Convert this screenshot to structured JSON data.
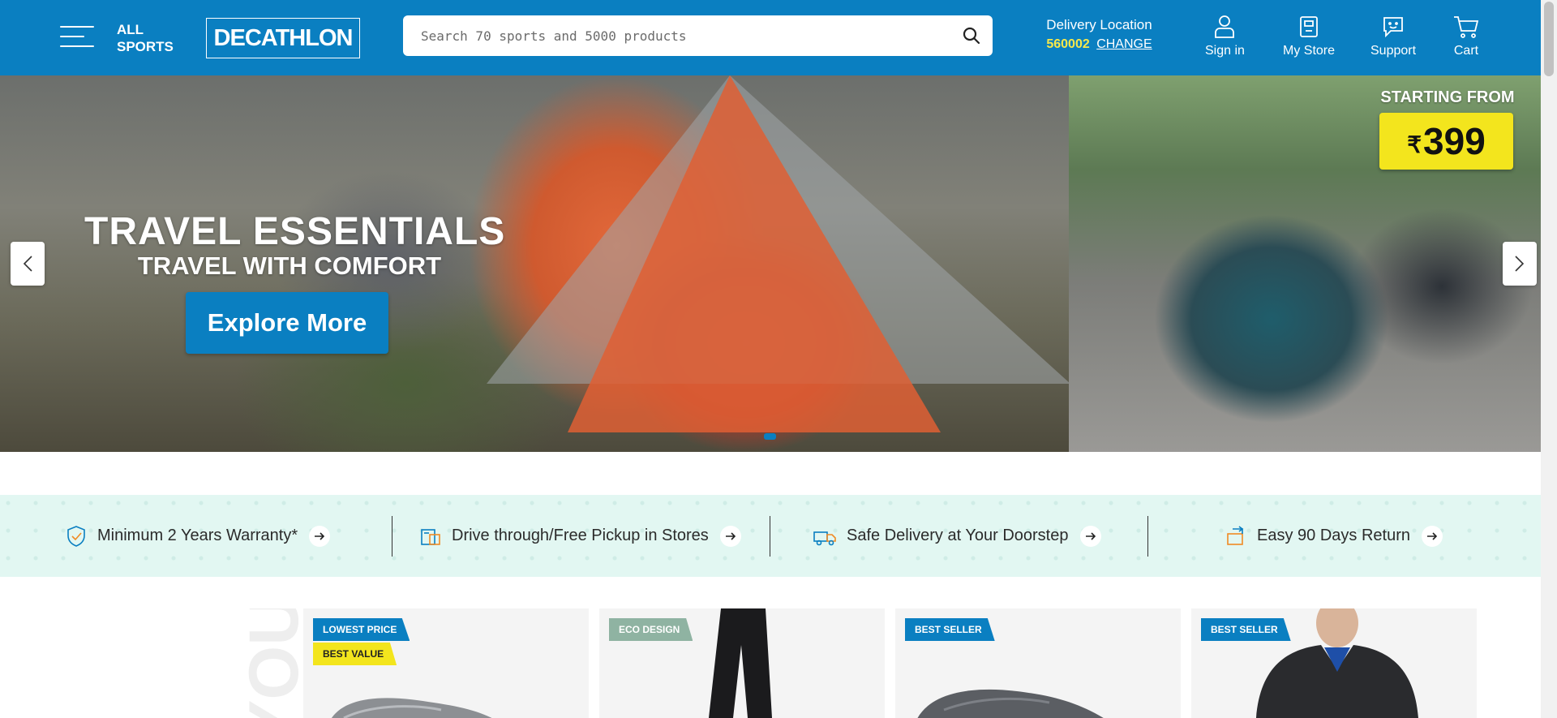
{
  "header": {
    "all_sports_label": "ALL SPORTS",
    "logo_text": "DECATHLON",
    "search_placeholder": "Search 70 sports and 5000 products",
    "delivery_title": "Delivery Location",
    "pincode": "560002",
    "change_label": "CHANGE",
    "nav": [
      {
        "label": "Sign in",
        "icon": "user-icon"
      },
      {
        "label": "My Store",
        "icon": "store-icon"
      },
      {
        "label": "Support",
        "icon": "chat-support-icon"
      },
      {
        "label": "Cart",
        "icon": "cart-icon"
      }
    ]
  },
  "hero": {
    "title": "TRAVEL ESSENTIALS",
    "subtitle": "TRAVEL WITH COMFORT",
    "cta_label": "Explore More",
    "starting_label": "STARTING FROM",
    "currency": "₹",
    "price": "399"
  },
  "benefits": [
    {
      "label": "Minimum 2 Years Warranty*",
      "icon": "warranty-shield-icon"
    },
    {
      "label": "Drive through/Free Pickup in Stores",
      "icon": "store-pickup-icon"
    },
    {
      "label": "Safe Delivery at Your Doorstep",
      "icon": "delivery-truck-icon"
    },
    {
      "label": "Easy 90 Days Return",
      "icon": "return-box-icon"
    }
  ],
  "products": {
    "side_text": "YOU",
    "cards": [
      {
        "tags": [
          "LOWEST PRICE",
          "BEST VALUE"
        ],
        "image": "grey-shoe"
      },
      {
        "tags": [
          "ECO DESIGN"
        ],
        "image": "black-pants"
      },
      {
        "tags": [
          "BEST SELLER"
        ],
        "image": "grey-shoe"
      },
      {
        "tags": [
          "BEST SELLER"
        ],
        "image": "black-jacket"
      }
    ]
  },
  "colors": {
    "brand_blue": "#0a7fc1",
    "accent_yellow": "#f3e51d",
    "eco_green": "#8fb3a2",
    "benefit_strip": "#e2f7f2"
  }
}
